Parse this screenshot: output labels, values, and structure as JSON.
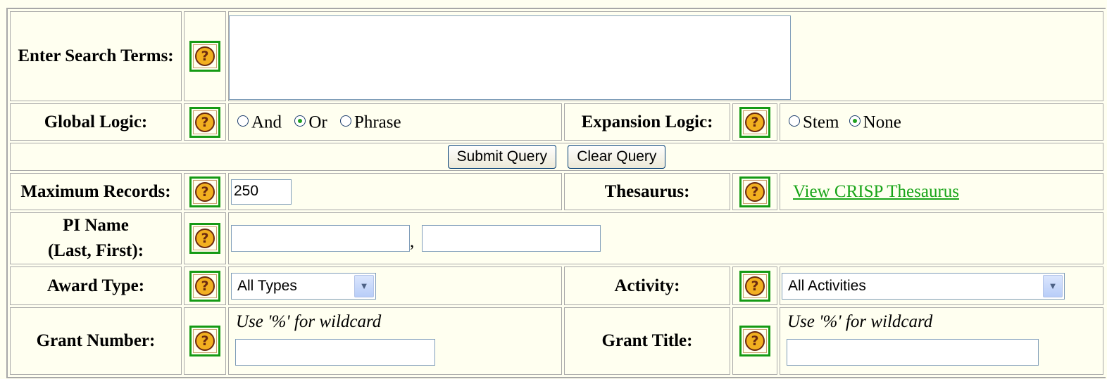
{
  "search_terms": {
    "label": "Enter Search Terms:",
    "value": ""
  },
  "global_logic": {
    "label": "Global Logic:",
    "options": [
      {
        "label": "And",
        "selected": false
      },
      {
        "label": "Or",
        "selected": true
      },
      {
        "label": "Phrase",
        "selected": false
      }
    ]
  },
  "expansion_logic": {
    "label": "Expansion Logic:",
    "options": [
      {
        "label": "Stem",
        "selected": false
      },
      {
        "label": "None",
        "selected": true
      }
    ]
  },
  "buttons": {
    "submit": "Submit Query",
    "clear": "Clear Query"
  },
  "max_records": {
    "label": "Maximum Records:",
    "value": "250"
  },
  "thesaurus": {
    "label": "Thesaurus:",
    "link": "View CRISP Thesaurus"
  },
  "pi_name": {
    "label_line1": "PI Name",
    "label_line2": "(Last, First):",
    "last": "",
    "first": "",
    "separator": ","
  },
  "award_type": {
    "label": "Award Type:",
    "selected": "All Types"
  },
  "activity": {
    "label": "Activity:",
    "selected": "All Activities"
  },
  "grant_number": {
    "label": "Grant Number:",
    "hint": "Use '%' for wildcard",
    "value": ""
  },
  "grant_title": {
    "label": "Grant Title:",
    "hint": "Use '%' for wildcard",
    "value": ""
  },
  "help_glyph": "?",
  "icons": {
    "help": "help-question-icon",
    "dropdown": "chevron-down-icon"
  },
  "colors": {
    "background": "#fffff0",
    "link": "#19a519",
    "help_border": "#159a15"
  }
}
